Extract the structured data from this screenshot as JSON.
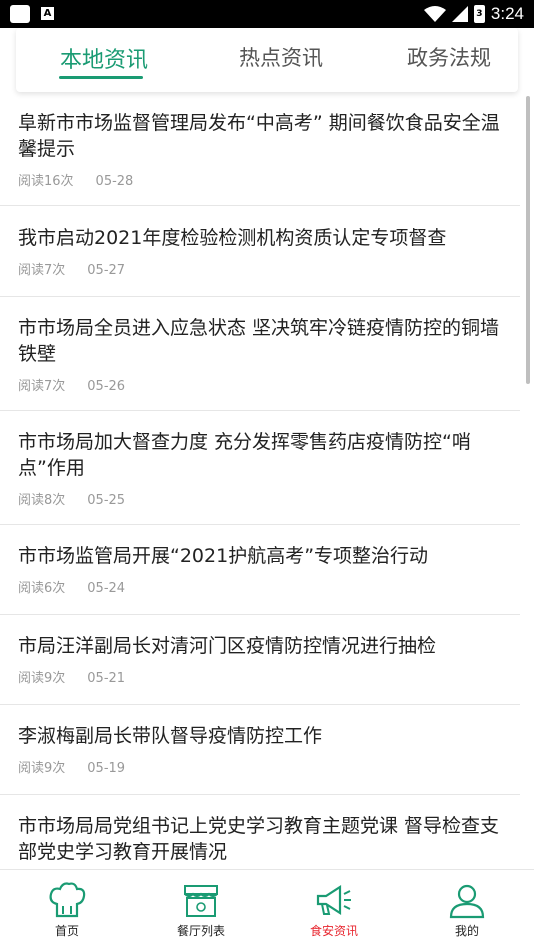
{
  "status_bar": {
    "time": "3:24",
    "battery_label": "3"
  },
  "tabs": [
    {
      "label": "本地资讯",
      "active": true
    },
    {
      "label": "热点资讯",
      "active": false
    },
    {
      "label": "政务法规",
      "active": false
    }
  ],
  "news": [
    {
      "title": "阜新市市场监督管理局发布“中高考” 期间餐饮食品安全温馨提示",
      "reads": "阅读16次",
      "date": "05-28"
    },
    {
      "title": "我市启动2021年度检验检测机构资质认定专项督查",
      "reads": "阅读7次",
      "date": "05-27"
    },
    {
      "title": "市市场局全员进入应急状态 坚决筑牢冷链疫情防控的铜墙铁壁",
      "reads": "阅读7次",
      "date": "05-26"
    },
    {
      "title": "市市场局加大督查力度 充分发挥零售药店疫情防控“哨点”作用",
      "reads": "阅读8次",
      "date": "05-25"
    },
    {
      "title": "市市场监管局开展“2021护航高考”专项整治行动",
      "reads": "阅读6次",
      "date": "05-24"
    },
    {
      "title": "市局汪洋副局长对清河门区疫情防控情况进行抽检",
      "reads": "阅读9次",
      "date": "05-21"
    },
    {
      "title": "李淑梅副局长带队督导疫情防控工作",
      "reads": "阅读9次",
      "date": "05-19"
    },
    {
      "title": "市市场局局党组书记上党史学习教育主题党课 督导检查支部党史学习教育开展情况",
      "reads": "",
      "date": ""
    }
  ],
  "bottom_nav": [
    {
      "label": "首页",
      "icon": "chef-hat-icon"
    },
    {
      "label": "餐厅列表",
      "icon": "restaurant-icon"
    },
    {
      "label": "食安资讯",
      "icon": "megaphone-icon",
      "active": true
    },
    {
      "label": "我的",
      "icon": "user-icon"
    }
  ],
  "colors": {
    "accent": "#1a9b73",
    "active_nav": "#e8262f"
  }
}
